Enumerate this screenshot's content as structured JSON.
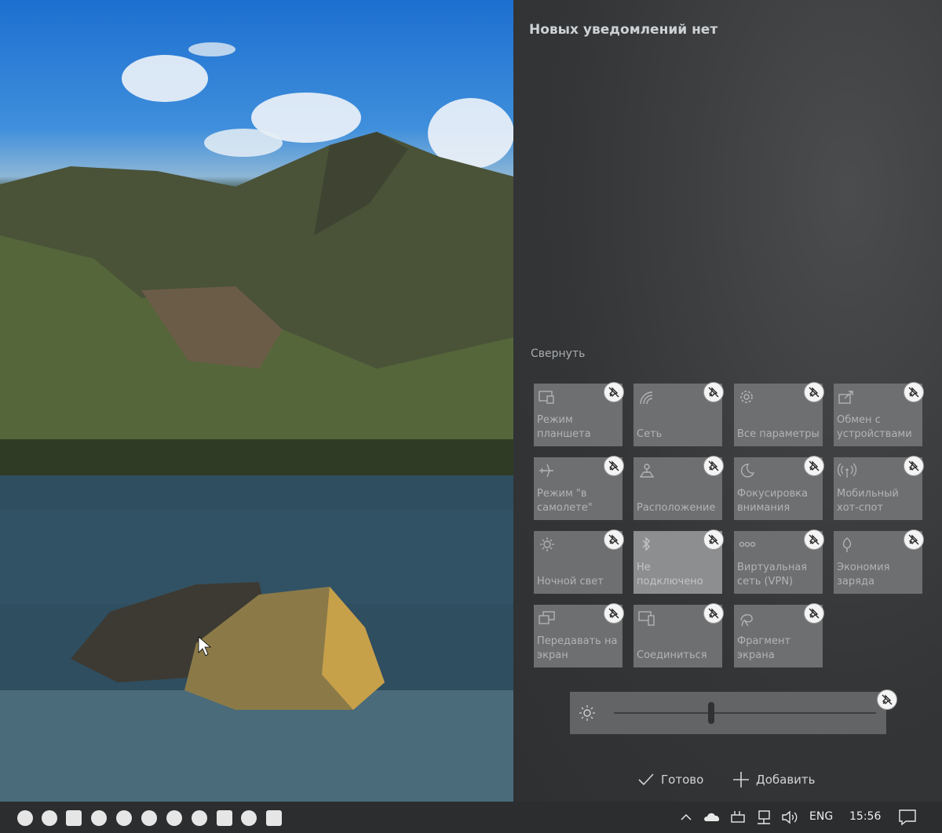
{
  "action_center": {
    "no_notifications": "Новых уведомлений нет",
    "collapse": "Свернуть",
    "tiles": [
      {
        "label": "Режим планшета",
        "icon": "tablet-mode-icon",
        "active": false
      },
      {
        "label": "Сеть",
        "icon": "network-icon",
        "active": false
      },
      {
        "label": "Все параметры",
        "icon": "gear-icon",
        "active": false
      },
      {
        "label": "Обмен с устройствами",
        "icon": "nearby-sharing-icon",
        "active": false
      },
      {
        "label": "Режим \"в самолете\"",
        "icon": "airplane-icon",
        "active": false
      },
      {
        "label": "Расположение",
        "icon": "location-icon",
        "active": false
      },
      {
        "label": "Фокусировка внимания",
        "icon": "moon-icon",
        "active": false
      },
      {
        "label": "Мобильный хот-спот",
        "icon": "hotspot-icon",
        "active": false
      },
      {
        "label": "Ночной свет",
        "icon": "night-light-icon",
        "active": false
      },
      {
        "label": "Не подключено",
        "icon": "bluetooth-icon",
        "active": true
      },
      {
        "label": "Виртуальная сеть (VPN)",
        "icon": "vpn-icon",
        "active": false
      },
      {
        "label": "Экономия заряда",
        "icon": "battery-saver-icon",
        "active": false
      },
      {
        "label": "Передавать на экран",
        "icon": "project-icon",
        "active": false
      },
      {
        "label": "Соединиться",
        "icon": "connect-icon",
        "active": false
      },
      {
        "label": "Фрагмент экрана",
        "icon": "screen-snip-icon",
        "active": false
      }
    ],
    "brightness": 0.37,
    "done_label": "Готово",
    "add_label": "Добавить"
  },
  "taskbar": {
    "apps": [
      "photoshop-icon",
      "telegram-icon",
      "photos-icon",
      "chrome-icon",
      "firefox-icon",
      "app-icon",
      "app-icon",
      "app-icon",
      "app-icon",
      "groove-icon",
      "app-icon"
    ],
    "language": "ENG",
    "time": "15:56"
  },
  "colors": {
    "panel": "#3a3c3e",
    "tile": "#6d6f71",
    "tile_active": "#8c8e8f",
    "taskbar": "#2b2d2f"
  }
}
